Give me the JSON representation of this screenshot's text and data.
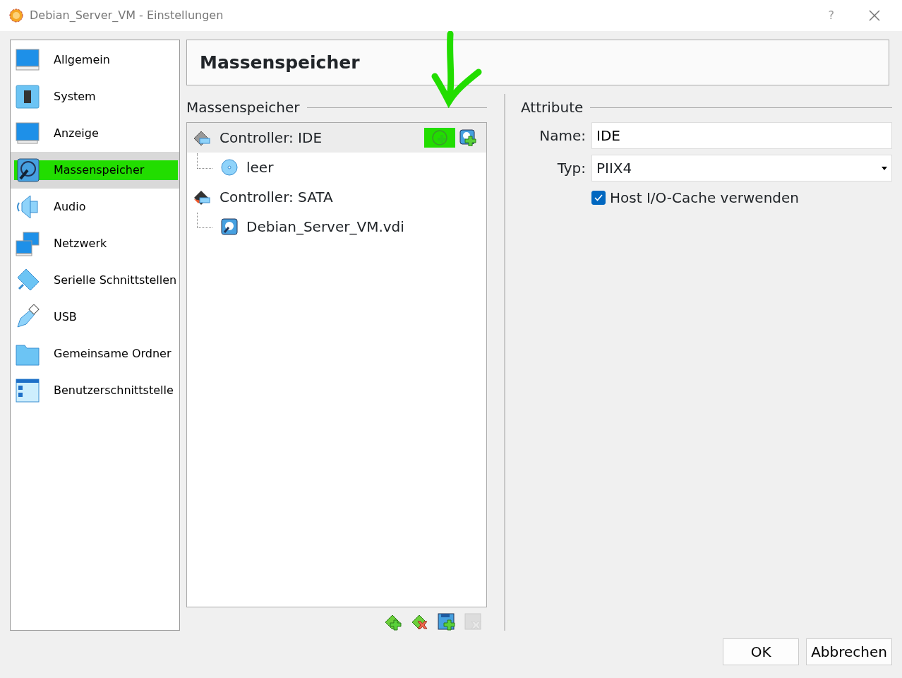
{
  "window": {
    "title": "Debian_Server_VM - Einstellungen",
    "help": "?"
  },
  "sidebar": {
    "items": [
      {
        "label": "Allgemein",
        "kind": "general",
        "selected": false,
        "highlighted": false
      },
      {
        "label": "System",
        "kind": "system",
        "selected": false,
        "highlighted": false
      },
      {
        "label": "Anzeige",
        "kind": "display",
        "selected": false,
        "highlighted": false
      },
      {
        "label": "Massenspeicher",
        "kind": "storage",
        "selected": true,
        "highlighted": true
      },
      {
        "label": "Audio",
        "kind": "audio",
        "selected": false,
        "highlighted": false
      },
      {
        "label": "Netzwerk",
        "kind": "network",
        "selected": false,
        "highlighted": false
      },
      {
        "label": "Serielle Schnittstellen",
        "kind": "serial",
        "selected": false,
        "highlighted": false
      },
      {
        "label": "USB",
        "kind": "usb",
        "selected": false,
        "highlighted": false
      },
      {
        "label": "Gemeinsame Ordner",
        "kind": "folder",
        "selected": false,
        "highlighted": false
      },
      {
        "label": "Benutzerschnittstelle",
        "kind": "ui",
        "selected": false,
        "highlighted": false
      }
    ]
  },
  "page_title": "Massenspeicher",
  "storage": {
    "heading": "Massenspeicher",
    "tree": [
      {
        "label": "Controller: IDE",
        "kind": "ide",
        "selected": true,
        "actions": [
          {
            "kind": "add-optical",
            "highlighted": true
          },
          {
            "kind": "add-disk",
            "highlighted": false
          }
        ],
        "children": [
          {
            "label": "leer",
            "kind": "optical",
            "selected": false
          }
        ]
      },
      {
        "label": "Controller: SATA",
        "kind": "sata",
        "selected": false,
        "children": [
          {
            "label": "Debian_Server_VM.vdi",
            "kind": "disk",
            "selected": false
          }
        ]
      }
    ],
    "toolbar": [
      {
        "kind": "add-controller",
        "disabled": false
      },
      {
        "kind": "remove-controller",
        "disabled": false
      },
      {
        "kind": "add-attachment",
        "disabled": false
      },
      {
        "kind": "remove-attachment",
        "disabled": true
      }
    ]
  },
  "attributes": {
    "heading": "Attribute",
    "name": {
      "label": "Name:",
      "value": "IDE"
    },
    "type": {
      "label": "Typ:",
      "value": "PIIX4"
    },
    "host_cache": {
      "label": "Host I/O-Cache verwenden",
      "checked": true
    }
  },
  "buttons": [
    "OK",
    "Abbrechen"
  ]
}
